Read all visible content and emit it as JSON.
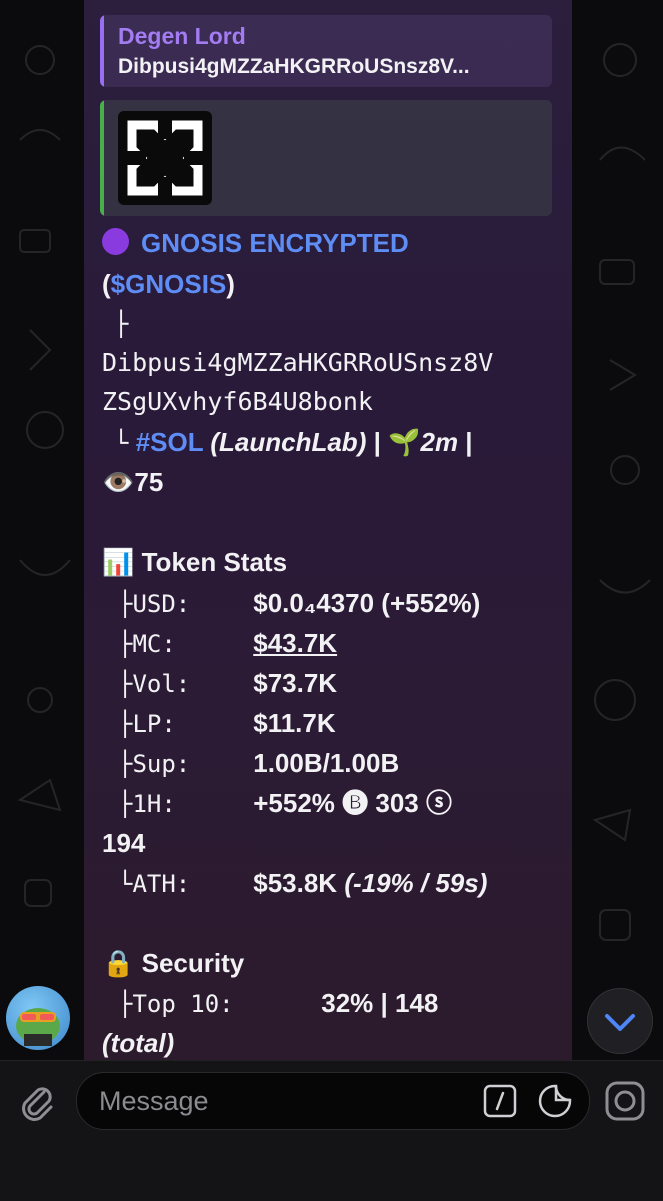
{
  "reply": {
    "name": "Degen Lord",
    "text": "Dibpusi4gMZZaHKGRRoUSnsz8V..."
  },
  "token": {
    "name": "GNOSIS ENCRYPTED",
    "open_paren": "(",
    "ticker": "$GNOSIS",
    "close_paren": ")",
    "branch1": "├",
    "address_line1": "Dibpusi4gMZZaHKGRRoUSnsz8V",
    "address_line2": "ZSgUXvhyf6B4U8bonk",
    "branch2": "└",
    "chain": "#SOL",
    "platform": "(LaunchLab)",
    "sep1": "|",
    "age_emoji": "🌱",
    "age": "2m",
    "sep2": "|",
    "views_emoji": "👁️",
    "views": "75"
  },
  "stats": {
    "header_emoji": "📊",
    "header": "Token Stats",
    "rows": [
      {
        "prefix": "├",
        "key": "USD:",
        "value": "$0.0₄4370 (+552%)"
      },
      {
        "prefix": "├",
        "key": "MC:",
        "value": "$43.7K"
      },
      {
        "prefix": "├",
        "key": "Vol:",
        "value": "$73.7K"
      },
      {
        "prefix": "├",
        "key": "LP:",
        "value": "$11.7K"
      },
      {
        "prefix": "├",
        "key": "Sup:",
        "value": "1.00B/1.00B"
      },
      {
        "prefix": "├",
        "key": "1H:",
        "value": "+552% 🅑 303 ⓢ"
      },
      {
        "prefix": "└",
        "key": "ATH:",
        "value": "$53.8K"
      }
    ],
    "wrap_1h": "194",
    "ath_extra": "(-19% / 59s)"
  },
  "security": {
    "header_emoji": "🔒",
    "header": "Security",
    "prefix": "├",
    "key": "Top 10:",
    "value": "32% | 148",
    "wrap": "(total)"
  },
  "composer": {
    "placeholder": "Message"
  },
  "colors": {
    "link": "#5d8df5",
    "reply_name": "#a37cf2",
    "accent_green": "#47b04b"
  }
}
